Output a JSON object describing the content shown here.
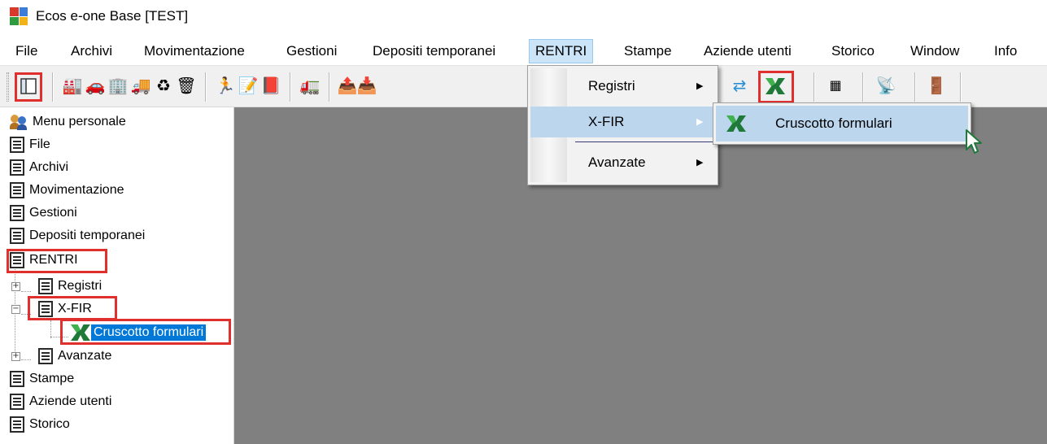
{
  "window": {
    "title": "Ecos e-one Base [TEST]"
  },
  "menubar": {
    "items": [
      "File",
      "Archivi",
      "Movimentazione",
      "Gestioni",
      "Depositi temporanei",
      "RENTRI",
      "Stampe",
      "Aziende utenti",
      "Storico",
      "Window",
      "Info"
    ],
    "active": "RENTRI"
  },
  "dropdown": {
    "items": [
      {
        "label": "Registri",
        "has_submenu": true
      },
      {
        "label": "X-FIR",
        "has_submenu": true,
        "highlighted": true
      },
      {
        "label": "Avanzate",
        "has_submenu": true
      }
    ]
  },
  "submenu": {
    "item_label": "Cruscotto formulari"
  },
  "tree": {
    "items": [
      {
        "label": "Menu personale",
        "icon": "people-icon"
      },
      {
        "label": "File",
        "icon": "document-list-icon"
      },
      {
        "label": "Archivi",
        "icon": "document-list-icon"
      },
      {
        "label": "Movimentazione",
        "icon": "document-list-icon"
      },
      {
        "label": "Gestioni",
        "icon": "document-list-icon"
      },
      {
        "label": "Depositi temporanei",
        "icon": "document-list-icon"
      },
      {
        "label": "RENTRI",
        "icon": "document-list-icon"
      },
      {
        "label": "Registri",
        "icon": "document-list-icon"
      },
      {
        "label": "X-FIR",
        "icon": "document-list-icon"
      },
      {
        "label": "Cruscotto formulari",
        "icon": "green-x-icon",
        "selected": true
      },
      {
        "label": "Avanzate",
        "icon": "document-list-icon"
      },
      {
        "label": "Stampe",
        "icon": "document-list-icon"
      },
      {
        "label": "Aziende utenti",
        "icon": "document-list-icon"
      },
      {
        "label": "Storico",
        "icon": "document-list-icon"
      }
    ]
  },
  "colors": {
    "highlight_box": "#e0302e",
    "workspace": "#808080",
    "selection": "#0078d7",
    "menu_hover": "#bcd6ee"
  }
}
